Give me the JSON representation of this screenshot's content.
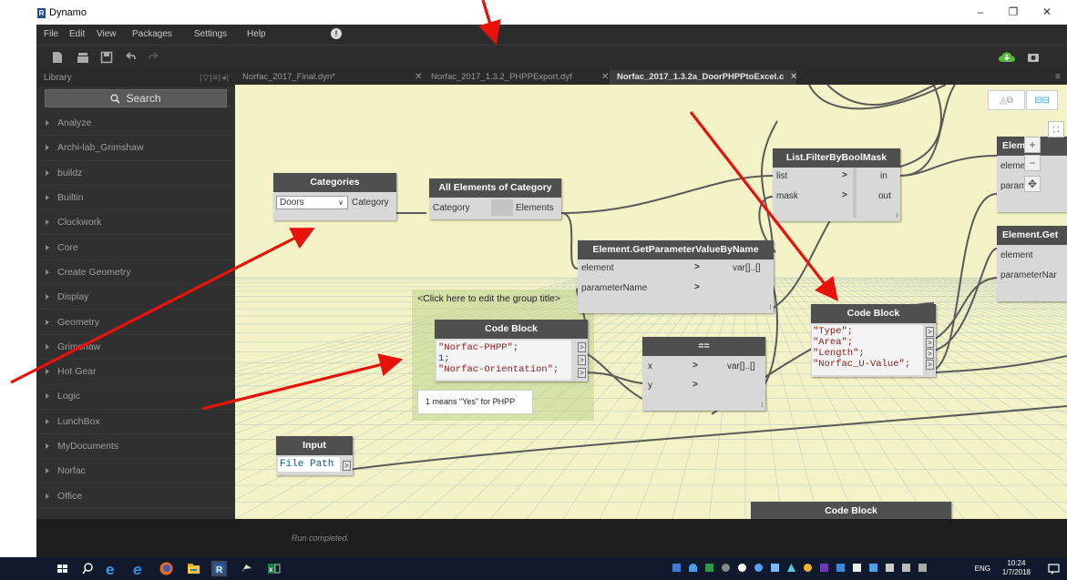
{
  "window": {
    "logo_letter": "R",
    "title": "Dynamo",
    "controls": {
      "minimize": "–",
      "restore": "❐",
      "close": "✕"
    }
  },
  "menu": {
    "items": [
      "File",
      "Edit",
      "View",
      "Packages",
      "Settings",
      "Help"
    ],
    "alert_glyph": "!"
  },
  "library": {
    "header": "Library",
    "search_placeholder": "Search",
    "items": [
      "Analyze",
      "Archi-lab_Grimshaw",
      "buildz",
      "Builtin",
      "Clockwork",
      "Core",
      "Create Geometry",
      "Display",
      "Geometry",
      "Grimshaw",
      "Hot Gear",
      "Logic",
      "LunchBox",
      "MyDocuments",
      "Norfac",
      "Office"
    ]
  },
  "tabs": [
    {
      "label": "Norfac_2017_Final.dyn*",
      "active": false
    },
    {
      "label": "Norfac_2017_1.3.2_PHPPExport.dyf",
      "active": false
    },
    {
      "label": "Norfac_2017_1.3.2a_DoorPHPPtoExcel.c",
      "active": true
    }
  ],
  "nodes": {
    "categories": {
      "title": "Categories",
      "selected": "Doors",
      "output": "Category"
    },
    "all_elements": {
      "title": "All Elements of Category",
      "input": "Category",
      "output": "Elements"
    },
    "filter": {
      "title": "List.FilterByBoolMask",
      "inputs": [
        "list",
        "mask"
      ],
      "outputs": [
        "in",
        "out"
      ],
      "lacing": "l"
    },
    "get_param_main": {
      "title": "Element.GetParameterValueByName",
      "inputs": [
        "element",
        "parameterName"
      ],
      "output": "var[]..[]",
      "lacing": "l"
    },
    "element_right_1": {
      "title": "Element",
      "inputs": [
        "element",
        "paramete"
      ]
    },
    "element_right_2": {
      "title": "Element.Get",
      "inputs": [
        "element",
        "parameterNar"
      ]
    },
    "code_block_left": {
      "title": "Code Block",
      "lines": [
        "\"Norfac-PHPP\";",
        "1;",
        "\"Norfac-Orientation\";"
      ]
    },
    "equals": {
      "title": "==",
      "inputs": [
        "x",
        "y"
      ],
      "output": "var[]..[]",
      "lacing": "l"
    },
    "code_block_right": {
      "title": "Code Block",
      "lines": [
        "\"Type\";",
        "\"Area\";",
        "\"Length\";",
        "\"Norfac_U-Value\";"
      ]
    },
    "input": {
      "title": "Input",
      "value": "File Path"
    },
    "code_block_bottom": {
      "title": "Code Block"
    }
  },
  "group": {
    "title": "<Click here to edit the group title>",
    "note": "1 means \"Yes\" for PHPP"
  },
  "status": "Run completed.",
  "taskbar": {
    "language": "ENG",
    "time": "10:24",
    "date": "1/7/2018"
  },
  "colors": {
    "canvas": "#f3f3c7",
    "node_header": "#4f4f4f",
    "node_body": "#d8d8d8",
    "arrow": "#e8120c",
    "group": "#bfd38c"
  }
}
